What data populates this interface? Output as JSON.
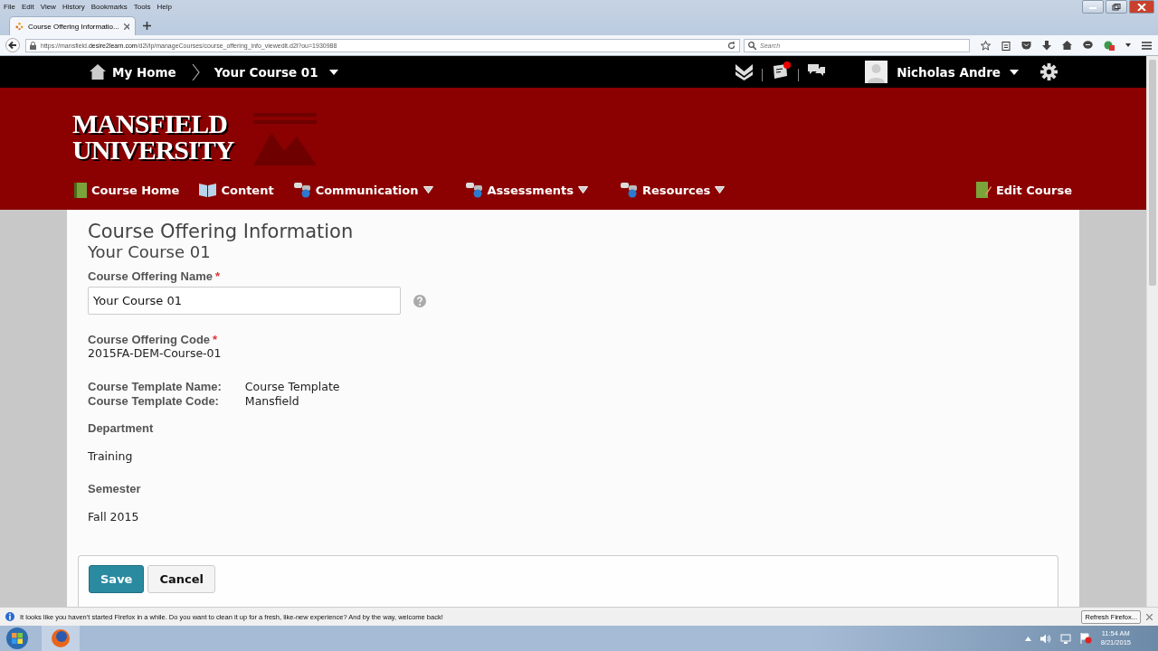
{
  "browser": {
    "menu": [
      "File",
      "Edit",
      "View",
      "History",
      "Bookmarks",
      "Tools",
      "Help"
    ],
    "tab": {
      "title": "Course Offering Informatio...",
      "selected": true
    },
    "url": {
      "host_pre": "https://mansfield.",
      "host_bold": "desire2learn.com",
      "path": "/d2l/lp/manageCourses/course_offering_info_viewedit.d2l?ou=1930988"
    },
    "search": {
      "placeholder": "Search"
    }
  },
  "topbar": {
    "home": "My Home",
    "course": "Your Course 01",
    "user": "Nicholas Andre",
    "alert_dot": true
  },
  "banner": {
    "logo_line1": "MANSFIELD",
    "logo_line2": "UNIVERSITY"
  },
  "navbar": [
    {
      "label": "Course Home",
      "kind": "book",
      "dropdown": false
    },
    {
      "label": "Content",
      "kind": "open-book",
      "dropdown": false
    },
    {
      "label": "Communication",
      "kind": "link",
      "dropdown": true
    },
    {
      "label": "Assessments",
      "kind": "link",
      "dropdown": true
    },
    {
      "label": "Resources",
      "kind": "link",
      "dropdown": true
    }
  ],
  "edit_course": "Edit Course",
  "page": {
    "title": "Course Offering Information",
    "subtitle": "Your Course 01",
    "name_label": "Course Offering Name",
    "name_required": "*",
    "name_value": "Your Course 01",
    "code_label": "Course Offering Code",
    "code_required": "*",
    "code_value": "2015FA-DEM-Course-01",
    "template_labels": [
      "Course Template Name:",
      "Course Template Code:"
    ],
    "template_values": [
      "Course Template",
      "Mansfield"
    ],
    "department_label": "Department",
    "department_value": "Training",
    "semester_label": "Semester",
    "semester_value": "Fall 2015"
  },
  "buttons": [
    {
      "label": "Save",
      "kind": "primary"
    },
    {
      "label": "Cancel",
      "kind": "secondary"
    }
  ],
  "notification": {
    "text": "It looks like you haven't started Firefox in a while. Do you want to clean it up for a fresh, like-new experience? And by the way, welcome back!",
    "button": "Refresh Firefox..."
  },
  "taskbar": {
    "time": "11:54 AM",
    "date": "8/21/2015"
  }
}
